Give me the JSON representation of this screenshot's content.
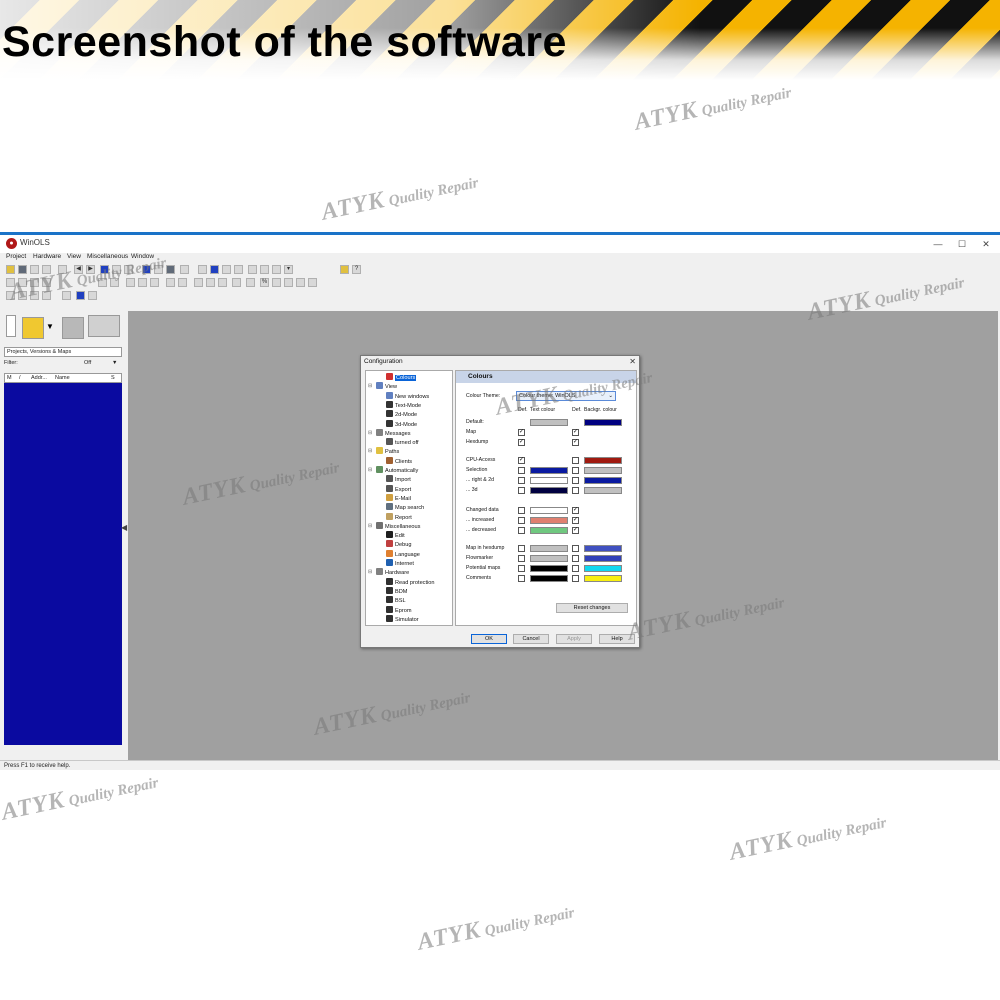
{
  "banner": {
    "title": "Screenshot of the software"
  },
  "window": {
    "title": "WinOLS",
    "controls": {
      "minimize": "—",
      "maximize": "☐",
      "close": "✕"
    },
    "menu": [
      "Project",
      "Hardware",
      "View",
      "Miscellaneous",
      "Window"
    ],
    "status": "Press F1 to receive help."
  },
  "left_panel": {
    "project_select": "Projects, Versions & Maps",
    "filter": {
      "label": "Filter:",
      "state": "Off"
    },
    "list_headers": [
      "M",
      "/",
      "Addr...",
      "Name",
      "S"
    ]
  },
  "dialog": {
    "title": "Configuration",
    "close": "✕",
    "tree": [
      {
        "label": "Colours",
        "level": 1,
        "selected": true,
        "icon": "colours-icon"
      },
      {
        "label": "View",
        "level": 0,
        "icon": "view-icon"
      },
      {
        "label": "New windows",
        "level": 1,
        "icon": "window-icon"
      },
      {
        "label": "Text-Mode",
        "level": 1,
        "icon": "text-icon"
      },
      {
        "label": "2d-Mode",
        "level": 1,
        "icon": "chart-2d-icon"
      },
      {
        "label": "3d-Mode",
        "level": 1,
        "icon": "chart-3d-icon"
      },
      {
        "label": "Messages",
        "level": 0,
        "icon": "messages-icon"
      },
      {
        "label": "turned off",
        "level": 1,
        "icon": "off-icon"
      },
      {
        "label": "Paths",
        "level": 0,
        "icon": "folder-icon"
      },
      {
        "label": "Clients",
        "level": 1,
        "icon": "clients-icon"
      },
      {
        "label": "Automatically",
        "level": 0,
        "icon": "auto-icon"
      },
      {
        "label": "Import",
        "level": 1,
        "icon": "import-icon"
      },
      {
        "label": "Export",
        "level": 1,
        "icon": "export-icon"
      },
      {
        "label": "E-Mail",
        "level": 1,
        "icon": "email-icon"
      },
      {
        "label": "Map search",
        "level": 1,
        "icon": "search-icon"
      },
      {
        "label": "Report",
        "level": 1,
        "icon": "report-icon"
      },
      {
        "label": "Miscellaneous",
        "level": 0,
        "icon": "misc-icon"
      },
      {
        "label": "Edit",
        "level": 1,
        "icon": "edit-icon"
      },
      {
        "label": "Debug",
        "level": 1,
        "icon": "debug-icon"
      },
      {
        "label": "Language",
        "level": 1,
        "icon": "language-icon"
      },
      {
        "label": "Internet",
        "level": 1,
        "icon": "globe-icon"
      },
      {
        "label": "Hardware",
        "level": 0,
        "icon": "hardware-icon"
      },
      {
        "label": "Read protection",
        "level": 1,
        "icon": "chip-icon"
      },
      {
        "label": "BDM",
        "level": 1,
        "icon": "chip-icon"
      },
      {
        "label": "BSL",
        "level": 1,
        "icon": "chip-icon"
      },
      {
        "label": "Eprom",
        "level": 1,
        "icon": "chip-icon"
      },
      {
        "label": "Simulator",
        "level": 1,
        "icon": "chip-icon"
      }
    ],
    "panel": {
      "header": "Colours",
      "theme_label": "Colour Theme:",
      "theme_value": "Colour theme: WinOLS",
      "col_def1": "Def.",
      "col_text": "Text colour",
      "col_def2": "Def.",
      "col_bg": "Backgr. colour",
      "rows": [
        {
          "label": "Default:",
          "def1": null,
          "text": "#c0c0c0",
          "def2": null,
          "bg": "#000080"
        },
        {
          "label": "Map",
          "def1": true,
          "text": null,
          "def2": true,
          "bg": null
        },
        {
          "label": "Hexdump",
          "def1": true,
          "text": null,
          "def2": true,
          "bg": null
        },
        {
          "label": "CPU-Access",
          "def1": true,
          "text": null,
          "def2": false,
          "bg": "#a01a10"
        },
        {
          "label": "Selection",
          "def1": false,
          "text": "#0a1aa0",
          "def2": false,
          "bg": "#c0c0c0"
        },
        {
          "label": "... right & 2d",
          "def1": false,
          "text": "#ffffff",
          "def2": false,
          "bg": "#0a1aa0"
        },
        {
          "label": "... 3d",
          "def1": false,
          "text": "#000040",
          "def2": false,
          "bg": "#c0c0c0"
        },
        {
          "label": "Changed data",
          "def1": false,
          "text": "#ffffff",
          "def2": true,
          "bg": null
        },
        {
          "label": "... increased",
          "def1": false,
          "text": "#e08070",
          "def2": true,
          "bg": null
        },
        {
          "label": "... decreased",
          "def1": false,
          "text": "#70c880",
          "def2": true,
          "bg": null
        },
        {
          "label": "Map in hexdump",
          "def1": false,
          "text": "#c0c0c0",
          "def2": false,
          "bg": "#4050c0"
        },
        {
          "label": "Flowmarker",
          "def1": false,
          "text": "#c0c0c0",
          "def2": false,
          "bg": "#3040b8"
        },
        {
          "label": "Potential maps",
          "def1": false,
          "text": "#000000",
          "def2": false,
          "bg": "#10d8f0"
        },
        {
          "label": "Comments",
          "def1": false,
          "text": "#000000",
          "def2": false,
          "bg": "#f8f010"
        }
      ],
      "reset_button": "Reset changes"
    },
    "buttons": {
      "ok": "OK",
      "cancel": "Cancel",
      "apply": "Apply",
      "help": "Help"
    }
  },
  "watermark": {
    "brand": "ATYK",
    "line": "Quality Repair"
  },
  "colors": {
    "accent": "#1a73c8",
    "list_bg": "#0a0aa0",
    "mdi_bg": "#a0a0a0",
    "selection": "#0a64d8"
  }
}
